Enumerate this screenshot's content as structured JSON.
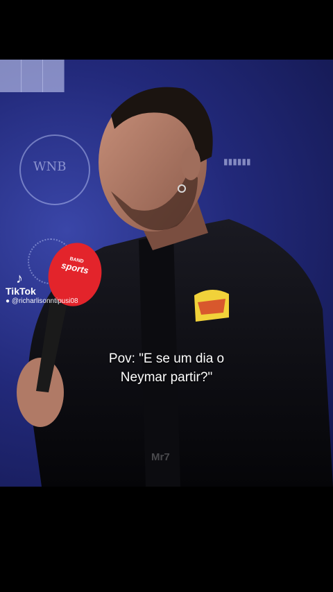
{
  "caption": {
    "line1": "Pov: \"E se um dia o",
    "line2": "Neymar partir?\""
  },
  "mic": {
    "brand_top": "BAND",
    "brand_main": "sports"
  },
  "tiktok": {
    "icon": "tiktok-note-icon",
    "label": "TikTok",
    "user_icon": "person-icon",
    "username": "@richarlisonntipusi08"
  },
  "watermark": "Mr7",
  "colors": {
    "background": "#000000",
    "backdrop": "#2a318a",
    "mic": "#e3242b",
    "caption": "#ffffff"
  }
}
